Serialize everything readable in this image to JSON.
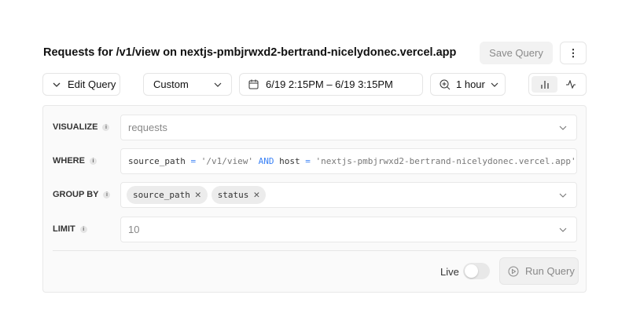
{
  "header": {
    "title": "Requests for /v1/view on nextjs-pmbjrwxd2-bertrand-nicelydonec.vercel.app",
    "save_label": "Save Query",
    "more_icon": "more-vertical-icon"
  },
  "toolbar": {
    "edit_label": "Edit Query",
    "range_type": "Custom",
    "date_range": "6/19 2:15PM – 6/19 3:15PM",
    "granularity": "1 hour"
  },
  "query": {
    "visualize": {
      "label": "VISUALIZE",
      "value": "requests"
    },
    "where": {
      "label": "WHERE",
      "tokens": [
        "source_path",
        " = ",
        "'/v1/view'",
        " AND ",
        "host",
        " = ",
        "'nextjs-pmbjrwxd2-bertrand-nicelydonec.vercel.app'"
      ]
    },
    "group_by": {
      "label": "GROUP BY",
      "chips": [
        "source_path",
        "status"
      ]
    },
    "limit": {
      "label": "LIMIT",
      "value": "10"
    },
    "info": "i"
  },
  "footer": {
    "live_label": "Live",
    "live": false,
    "run_label": "Run Query"
  },
  "colors": {
    "keyword": "#3b82f6",
    "string": "#777777"
  }
}
